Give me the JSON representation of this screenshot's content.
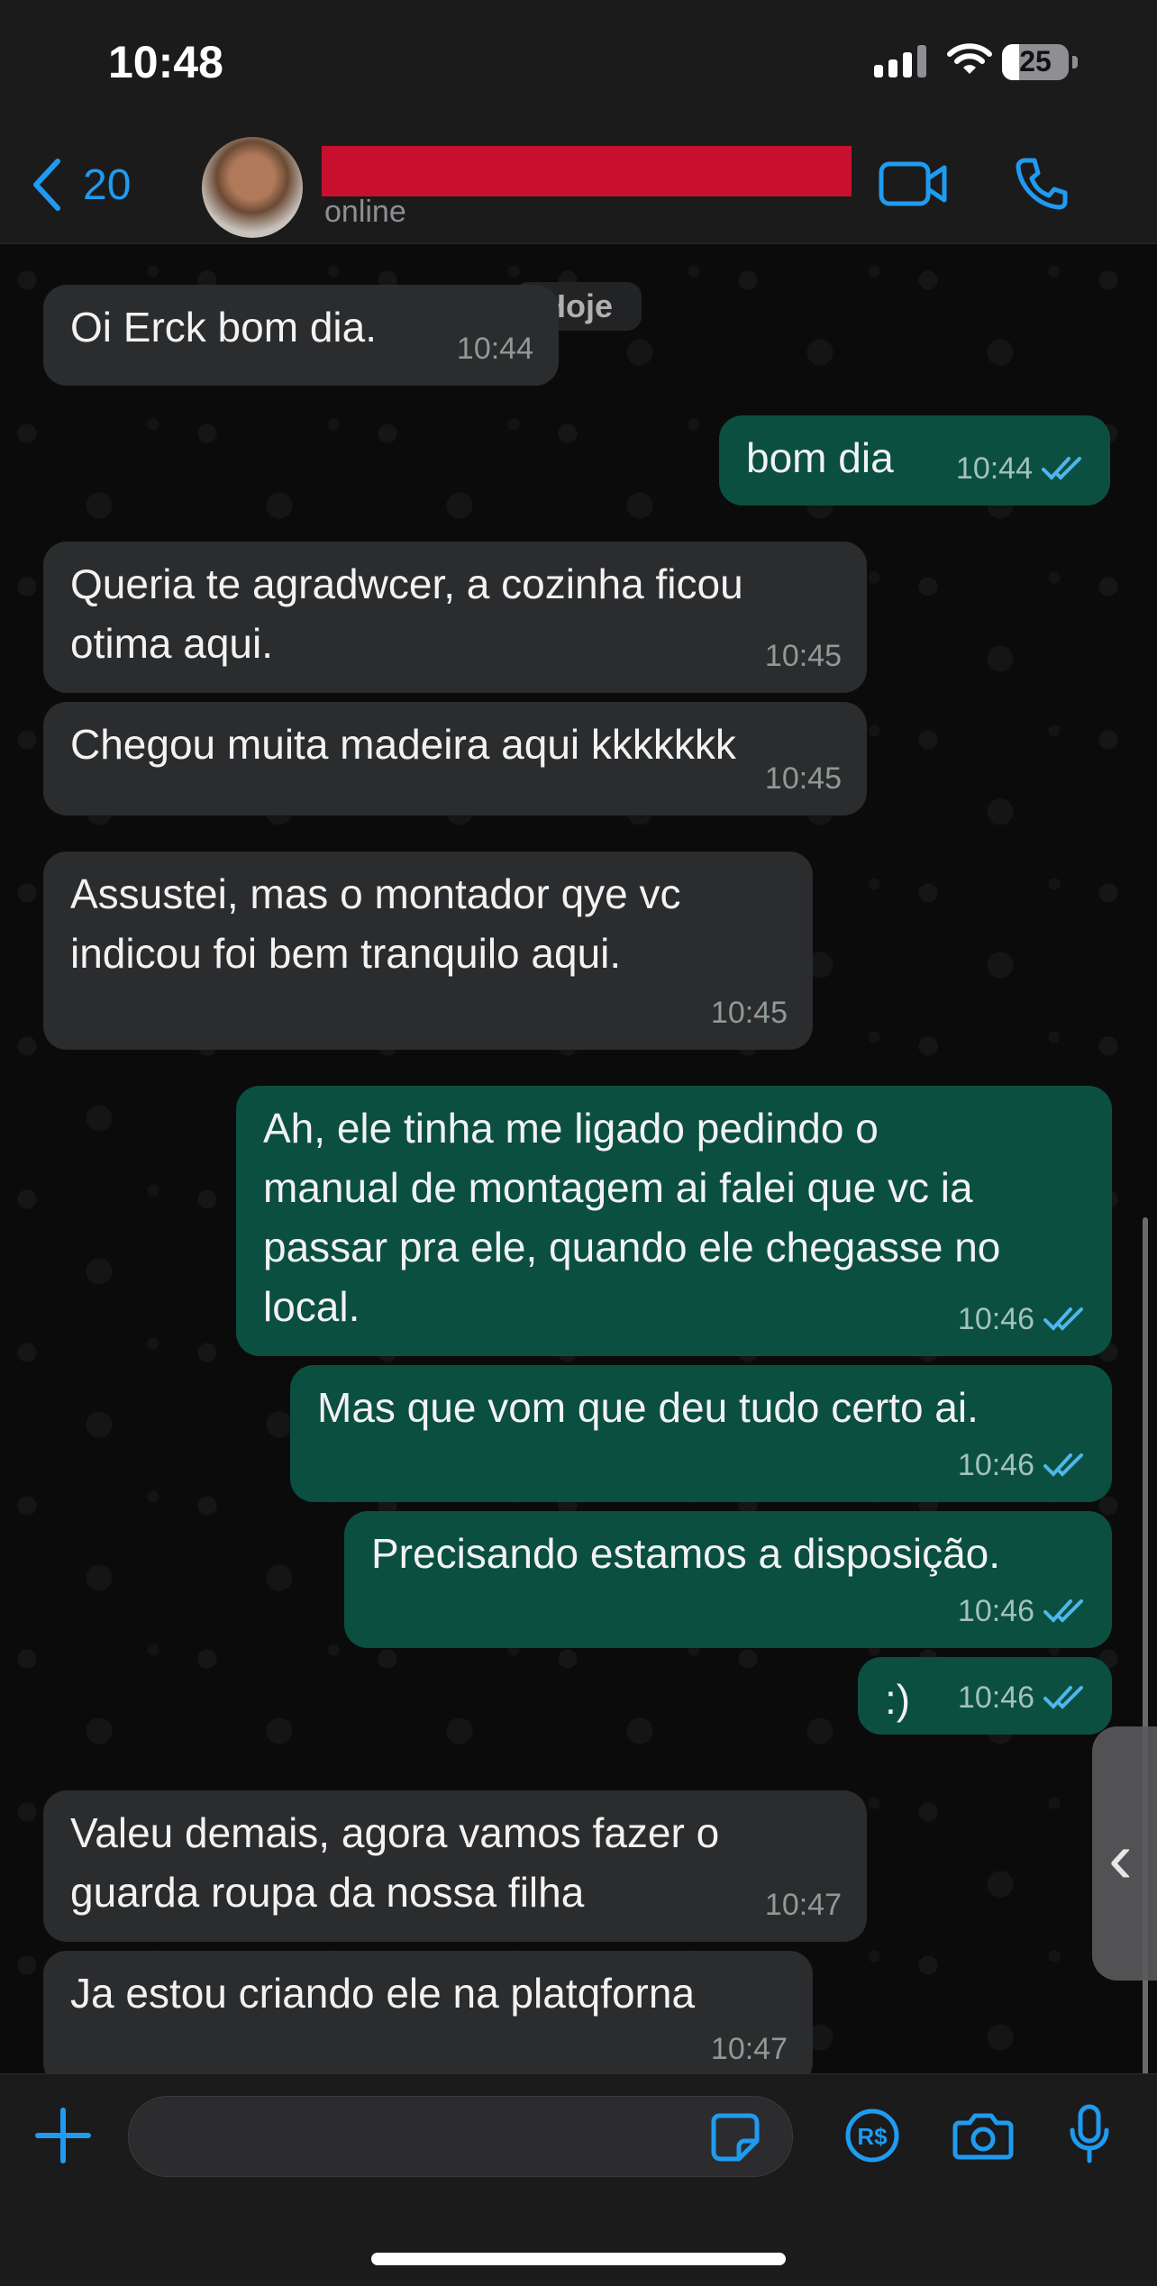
{
  "status_bar": {
    "time": "10:48",
    "battery": "25",
    "battery_level": 0.25
  },
  "header": {
    "back_count": "20",
    "presence": "online"
  },
  "chat": {
    "day_label": "Hoje",
    "messages": [
      {
        "dir": "in",
        "lines": [
          "Oi Erck bom dia."
        ],
        "time": "10:44"
      },
      {
        "dir": "out",
        "lines": [
          "bom dia"
        ],
        "time": "10:44",
        "read": true
      },
      {
        "dir": "in",
        "lines": [
          "Queria te agradwcer, a cozinha ficou",
          "otima aqui."
        ],
        "time": "10:45"
      },
      {
        "dir": "in",
        "lines": [
          "Chegou muita madeira aqui kkkkkkk"
        ],
        "time": "10:45"
      },
      {
        "dir": "in",
        "lines": [
          "Assustei, mas o montador qye vc",
          "indicou foi bem tranquilo aqui."
        ],
        "time": "10:45"
      },
      {
        "dir": "out",
        "lines": [
          "Ah, ele tinha me ligado pedindo o",
          "manual de montagem ai falei que vc ia",
          "passar pra ele, quando ele chegasse no",
          "local."
        ],
        "time": "10:46",
        "read": true
      },
      {
        "dir": "out",
        "lines": [
          "Mas que vom que deu tudo certo ai."
        ],
        "time": "10:46",
        "read": true
      },
      {
        "dir": "out",
        "lines": [
          "Precisando estamos a disposição."
        ],
        "time": "10:46",
        "read": true
      },
      {
        "dir": "out",
        "lines": [
          ":)"
        ],
        "time": "10:46",
        "read": true
      },
      {
        "dir": "in",
        "lines": [
          "Valeu demais, agora vamos fazer o",
          "guarda roupa da nossa filha"
        ],
        "time": "10:47"
      },
      {
        "dir": "in",
        "lines": [
          "Ja estou criando ele na platqforna"
        ],
        "time": "10:47"
      }
    ]
  },
  "colors": {
    "accent": "#1f9bf0",
    "incoming": "#2b2c2e",
    "outgoing": "#0b4f40",
    "read_ticks": "#4fb6ec"
  },
  "icons": [
    "back-chevron-icon",
    "video-call-icon",
    "phone-icon",
    "plus-icon",
    "sticker-icon",
    "payment-icon",
    "camera-icon",
    "microphone-icon"
  ]
}
